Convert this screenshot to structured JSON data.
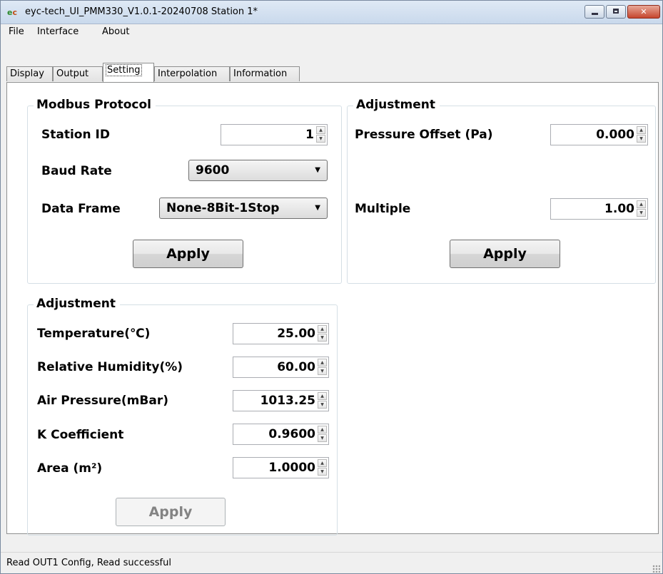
{
  "window": {
    "app_icon_text": [
      "e",
      "c"
    ],
    "title": "eyc-tech_UI_PMM330_V1.0.1-20240708  Station 1*",
    "controls": {
      "minimize": "minimize",
      "maximize": "maximize",
      "close": "✕"
    }
  },
  "menu": [
    "File",
    "Interface",
    "About"
  ],
  "tabs": [
    "Display",
    "Output",
    "Setting",
    "Interpolation",
    "Information"
  ],
  "active_tab": "Setting",
  "modbus": {
    "title": "Modbus Protocol",
    "station_id_label": "Station ID",
    "station_id_value": "1",
    "baud_rate_label": "Baud Rate",
    "baud_rate_value": "9600",
    "data_frame_label": "Data Frame",
    "data_frame_value": "None-8Bit-1Stop",
    "apply_label": "Apply"
  },
  "adjust_right": {
    "title": "Adjustment",
    "pressure_offset_label": "Pressure Offset  (Pa)",
    "pressure_offset_value": "0.000",
    "multiple_label": "Multiple",
    "multiple_value": "1.00",
    "apply_label": "Apply"
  },
  "adjust_left": {
    "title": "Adjustment",
    "temperature_label": "Temperature(℃)",
    "temperature_value": "25.00",
    "humidity_label": "Relative Humidity(%)",
    "humidity_value": "60.00",
    "air_pressure_label": "Air Pressure(mBar)",
    "air_pressure_value": "1013.25",
    "k_coefficient_label": "K Coefficient",
    "k_coefficient_value": "0.9600",
    "area_label": "Area (m²)",
    "area_value": "1.0000",
    "apply_label": "Apply",
    "apply_enabled": false
  },
  "status": {
    "text": "Read OUT1 Config,   Read successful"
  },
  "icons": {
    "spin_up": "▲",
    "spin_down": "▼",
    "dropdown": "▼"
  },
  "colors": {
    "title_bar": "#c9d9ec",
    "close_button": "#c6462e",
    "group_border": "#d5dfe5",
    "disabled_text": "#838383"
  }
}
